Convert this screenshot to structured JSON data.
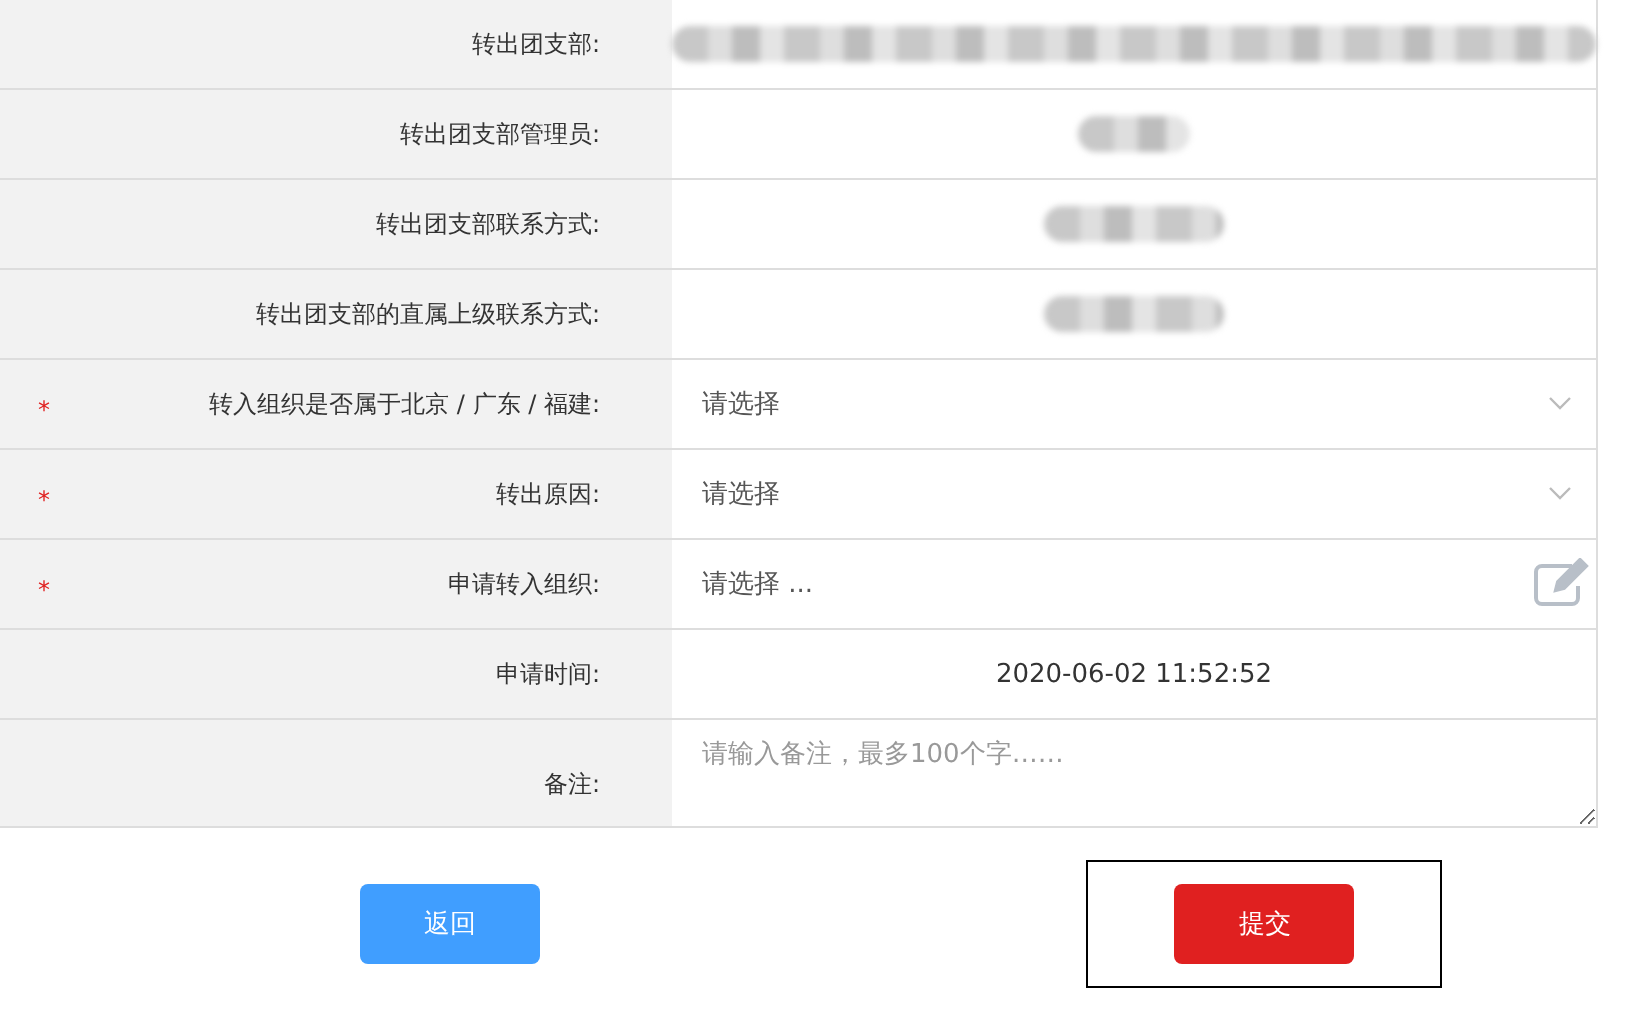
{
  "form": {
    "rows": [
      {
        "label": "转出团支部:",
        "kind": "redacted"
      },
      {
        "label": "转出团支部管理员:",
        "kind": "redacted"
      },
      {
        "label": "转出团支部联系方式:",
        "kind": "redacted"
      },
      {
        "label": "转出团支部的直属上级联系方式:",
        "kind": "redacted"
      },
      {
        "marker": "*",
        "label": "转入组织是否属于北京 / 广东 / 福建:",
        "kind": "select",
        "placeholder": "请选择"
      },
      {
        "marker": "*",
        "label": "转出原因:",
        "kind": "select",
        "placeholder": "请选择"
      },
      {
        "marker": "*",
        "label": "申请转入组织:",
        "kind": "picker",
        "placeholder": "请选择 ..."
      },
      {
        "label": "申请时间:",
        "kind": "text",
        "value": "2020-06-02 11:52:52"
      },
      {
        "label": "备注:",
        "kind": "textarea",
        "placeholder": "请输入备注，最多100个字……"
      }
    ]
  },
  "buttons": [
    {
      "label": "返回",
      "kind": "back",
      "highlighted": false
    },
    {
      "label": "提交",
      "kind": "submit",
      "highlighted": true
    }
  ]
}
